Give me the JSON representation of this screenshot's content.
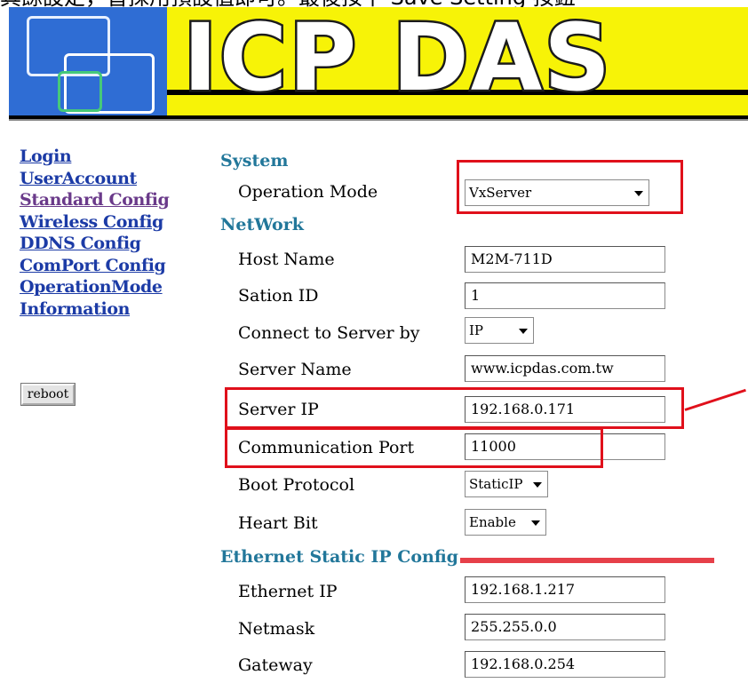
{
  "caption": "其餘設定，皆採用預設值即可。最後按下 Save Setting 按鈕",
  "logo": {
    "text": "ICP DAS"
  },
  "sidebar": {
    "items": [
      {
        "label": "Login"
      },
      {
        "label": "UserAccount"
      },
      {
        "label": "Standard Config"
      },
      {
        "label": "Wireless Config"
      },
      {
        "label": "DDNS Config"
      },
      {
        "label": "ComPort Config"
      },
      {
        "label": "OperationMode"
      },
      {
        "label": "Information"
      }
    ],
    "reboot_label": "reboot"
  },
  "form": {
    "system": {
      "title": "System",
      "operation_mode": {
        "label": "Operation Mode",
        "value": "VxServer"
      }
    },
    "network": {
      "title": "NetWork",
      "host_name": {
        "label": "Host Name",
        "value": "M2M-711D"
      },
      "station_id": {
        "label": "Sation ID",
        "value": "1"
      },
      "connect_by": {
        "label": "Connect to Server by",
        "value": "IP"
      },
      "server_name": {
        "label": "Server Name",
        "value": "www.icpdas.com.tw"
      },
      "server_ip": {
        "label": "Server IP",
        "value": "192.168.0.171"
      },
      "comm_port": {
        "label": "Communication Port",
        "value": "11000"
      },
      "boot_protocol": {
        "label": "Boot Protocol",
        "value": "StaticIP"
      },
      "heart_bit": {
        "label": "Heart Bit",
        "value": "Enable"
      }
    },
    "ethernet": {
      "title": "Ethernet Static IP Config",
      "ethernet_ip": {
        "label": "Ethernet IP",
        "value": "192.168.1.217"
      },
      "netmask": {
        "label": "Netmask",
        "value": "255.255.0.0"
      },
      "gateway": {
        "label": "Gateway",
        "value": "192.168.0.254"
      }
    }
  },
  "colors": {
    "link": "#1c3ba6",
    "visited_link": "#6a3a8a",
    "section_heading": "#22779a",
    "highlight": "#e0101b",
    "banner_yellow": "#f7f307",
    "banner_blue": "#2f6dd4"
  }
}
